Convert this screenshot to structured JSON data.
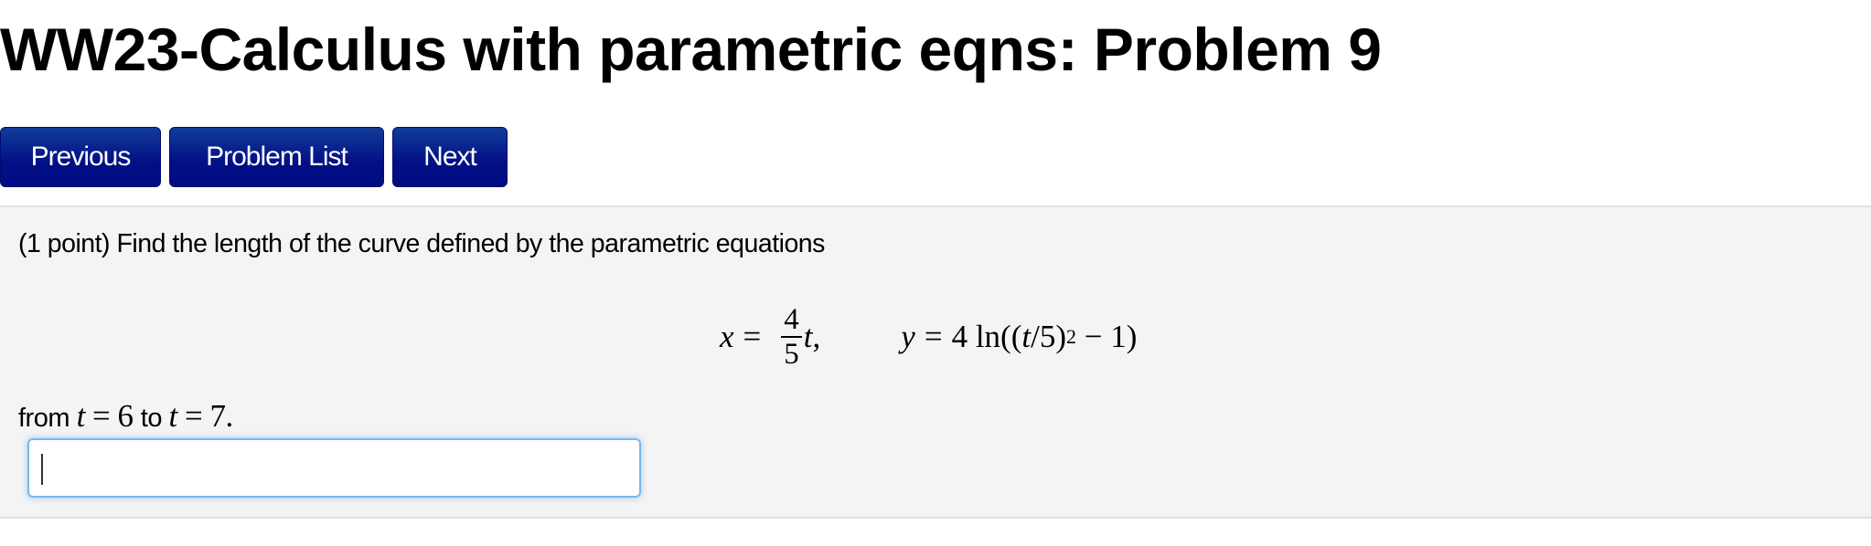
{
  "page": {
    "title": "WW23-Calculus with parametric eqns: Problem 9"
  },
  "nav": {
    "previous_label": "Previous",
    "problem_list_label": "Problem List",
    "next_label": "Next",
    "button_color": "#020f86"
  },
  "problem": {
    "points": "(1 point)",
    "prompt": "Find the length of the curve defined by the parametric equations",
    "x_equation": {
      "lhs": "x",
      "equals": "=",
      "numerator": "4",
      "denominator": "5",
      "variable": "t",
      "trailing": ","
    },
    "y_equation": {
      "lhs": "y",
      "equals": "=",
      "rhs_prefix": "4 ln((",
      "rhs_var": "t",
      "rhs_mid": "/5)",
      "exponent": "2",
      "rhs_suffix": " − 1)"
    },
    "range": {
      "from_word": "from",
      "var1": "t",
      "eq1": " = 6 ",
      "to_word": "to",
      "var2": "t",
      "eq2": " = 7."
    }
  },
  "answer": {
    "value": "",
    "placeholder": "",
    "focus_color": "#7fb6ea"
  }
}
